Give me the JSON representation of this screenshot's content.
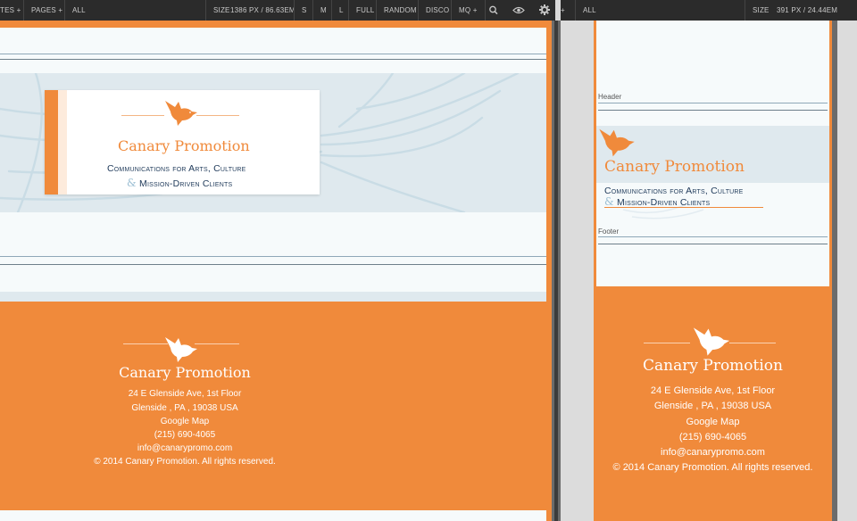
{
  "toolbar_left": {
    "items": [
      "TES +",
      "PAGES +",
      "ALL"
    ],
    "size_label": "SIZE",
    "size_value": "1386 PX / 86.63EM",
    "buttons": [
      "S",
      "M",
      "L",
      "FULL",
      "RANDOM",
      "DISCO",
      "MQ +"
    ],
    "icons": [
      "search-icon",
      "eye-icon",
      "gear-icon"
    ]
  },
  "toolbar_right": {
    "plus": "+",
    "all": "ALL",
    "size_label": "SIZE",
    "size_value": "391 PX / 24.44EM"
  },
  "brand": {
    "name": "Canary Promotion",
    "tagline_line1": "Communications for Arts, Culture",
    "amp": "&",
    "tagline_line2": "Mission-Driven Clients"
  },
  "mobile_labels": {
    "header": "Header",
    "footer": "Footer"
  },
  "footer": {
    "address1": "24 E Glenside Ave, 1st Floor",
    "address2": "Glenside , PA , 19038 USA",
    "map_link": "Google Map",
    "phone": "(215) 690-4065",
    "email": "info@canarypromo.com",
    "copyright": "© 2014 Canary Promotion. All rights reserved."
  },
  "colors": {
    "orange": "#f08a3b",
    "navy": "#1f3a5a",
    "pale_blue": "#dfe9ee",
    "toolbar": "#2b2b2b"
  }
}
